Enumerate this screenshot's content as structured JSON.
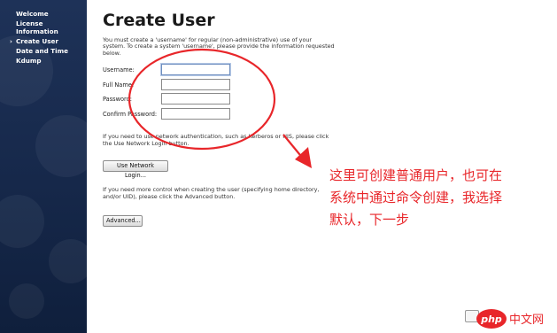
{
  "sidebar": {
    "items": [
      {
        "label": "Welcome",
        "active": false
      },
      {
        "label": "License Information",
        "active": false
      },
      {
        "label": "Create User",
        "active": true
      },
      {
        "label": "Date and Time",
        "active": false
      },
      {
        "label": "Kdump",
        "active": false
      }
    ],
    "arrow": "›"
  },
  "main": {
    "title": "Create User",
    "intro": "You must create a 'username' for regular (non-administrative) use of your system. To create a system 'username', please provide the information requested below.",
    "fields": [
      {
        "label": "Username:",
        "value": ""
      },
      {
        "label": "Full Name:",
        "value": ""
      },
      {
        "label": "Password:",
        "value": ""
      },
      {
        "label": "Confirm Password:",
        "value": ""
      }
    ],
    "network_text": "If you need to use network authentication, such as Kerberos or NIS, please click the Use Network Login button.",
    "network_button": "Use Network Login...",
    "advanced_text": "If you need more control when creating the user (specifying home directory, and/or UID), please click the Advanced button.",
    "advanced_button": "Advanced..."
  },
  "annotation": {
    "lines": [
      "这里可创建普通用户，也可在",
      "系统中通过命令创建，我选择",
      "默认，下一步"
    ],
    "color": "#e8262a"
  },
  "watermark": {
    "text_php": "php",
    "text_cn": "中文网",
    "color": "#e8262a"
  }
}
